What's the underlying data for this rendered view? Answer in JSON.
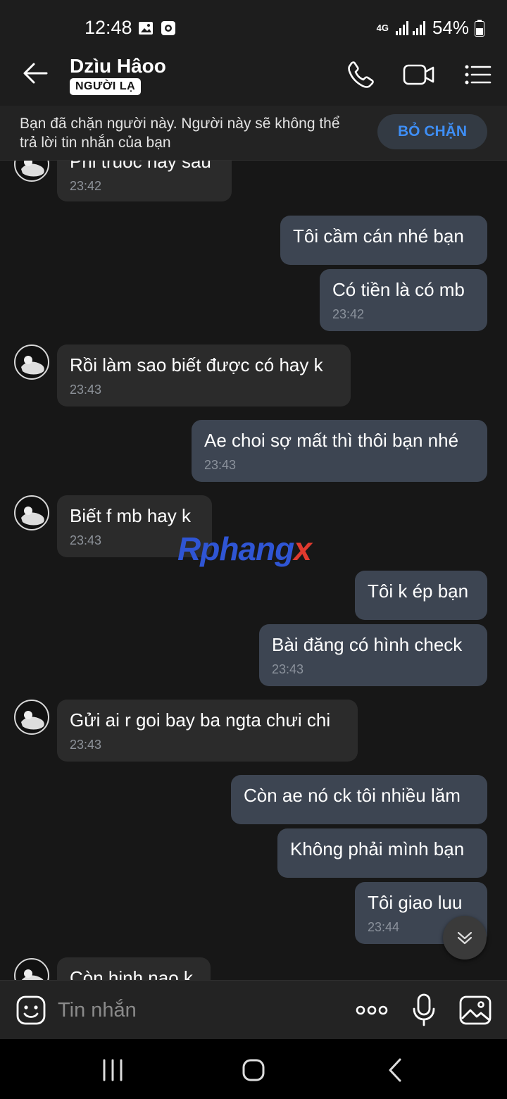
{
  "status_bar": {
    "time": "12:48",
    "network": "4G",
    "battery": "54%",
    "icons": [
      "image-notification-icon",
      "screen-record-icon",
      "signal-icon",
      "battery-icon"
    ]
  },
  "header": {
    "contact_name": "Dzìu Hâoo",
    "badge": "NGƯỜI LẠ",
    "icons": [
      "back-arrow-icon",
      "phone-icon",
      "video-icon",
      "menu-list-icon"
    ]
  },
  "banner": {
    "text": "Bạn đã chặn người này. Người này sẽ không thể trả lời tin nhắn của bạn",
    "button_label": "BỎ CHẶN"
  },
  "messages": [
    {
      "dir": "in",
      "text": "Phi truoc hay sau",
      "time": "23:42"
    },
    {
      "dir": "out",
      "text": "Tôi cầm cán nhé bạn",
      "time": ""
    },
    {
      "dir": "out",
      "text": "Có tiền là có mb",
      "time": "23:42"
    },
    {
      "dir": "in",
      "text": "Rồi làm sao biết được có hay k",
      "time": "23:43"
    },
    {
      "dir": "out",
      "text": "Ae choi sợ mất thì thôi bạn nhé",
      "time": "23:43"
    },
    {
      "dir": "in",
      "text": "Biết f mb hay k",
      "time": "23:43"
    },
    {
      "dir": "out",
      "text": "Tôi k ép bạn",
      "time": ""
    },
    {
      "dir": "out",
      "text": "Bài đăng có hình check",
      "time": "23:43"
    },
    {
      "dir": "in",
      "text": "Gửi ai r goi bay ba ngta chưi chi",
      "time": "23:43"
    },
    {
      "dir": "out",
      "text": "Còn ae nó ck tôi nhiều lăm",
      "time": ""
    },
    {
      "dir": "out",
      "text": "Không phải mình bạn",
      "time": ""
    },
    {
      "dir": "out",
      "text": "Tôi giao luu",
      "time": "23:44"
    },
    {
      "dir": "in",
      "text": "Còn hinh nao k",
      "time": ""
    }
  ],
  "watermark": {
    "text": "Rphangx",
    "color_main": "#2f55d4",
    "color_accent": "#e03a2f"
  },
  "composer": {
    "placeholder": "Tin nhắn",
    "icons": [
      "emoji-icon",
      "more-icon",
      "mic-icon",
      "gallery-icon"
    ]
  },
  "navbar": {
    "icons": [
      "recent-apps-icon",
      "home-icon",
      "back-icon"
    ]
  },
  "colors": {
    "accent": "#3e8ef5",
    "bubble_in": "#2b2b2b",
    "bubble_out": "#3d4552",
    "background": "#171717"
  }
}
